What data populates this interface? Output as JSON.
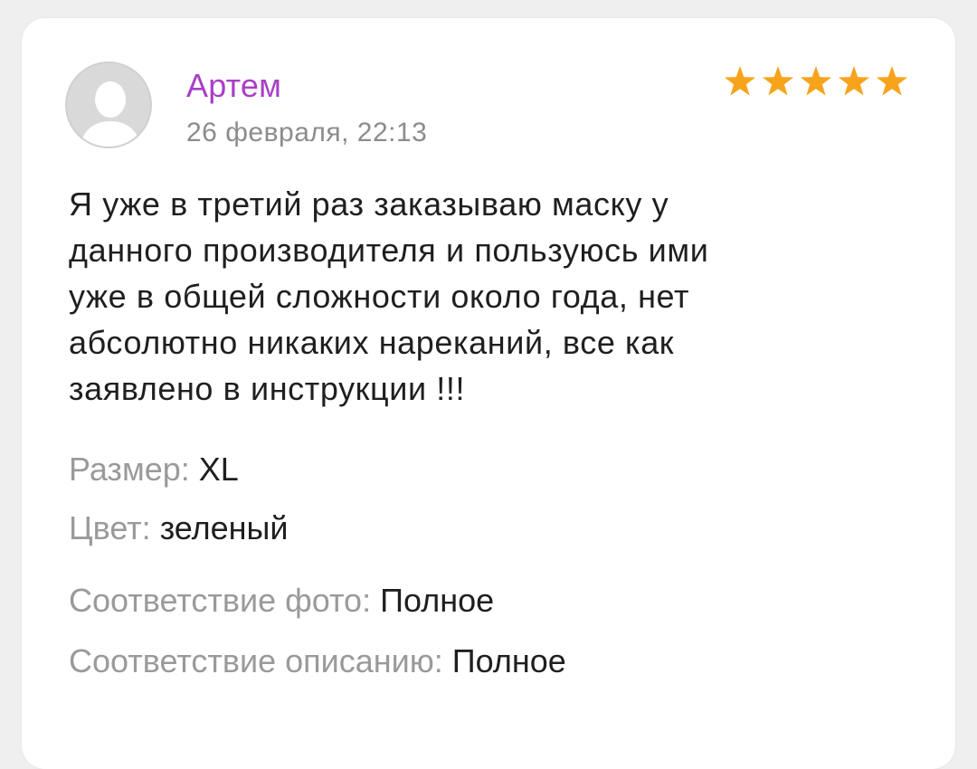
{
  "review": {
    "author": "Артем",
    "date": "26 февраля, 22:13",
    "rating": 5,
    "rating_max": 5,
    "text": "Я уже в третий  раз заказываю маску у\nданного производителя и пользуюсь ими\nуже  в общей сложности  около года, нет\nабсолютно никаких нареканий, все как\nзаявлено в инструкции !!!",
    "attributes": {
      "size_label": "Размер:",
      "size_value": "XL",
      "color_label": "Цвет:",
      "color_value": "зеленый",
      "photo_match_label": "Соответствие фото:",
      "photo_match_value": "Полное",
      "description_match_label": "Соответствие описанию:",
      "description_match_value": "Полное"
    }
  },
  "colors": {
    "author": "#a93fc6",
    "star": "#f7a41c",
    "muted": "#9a9a9a",
    "text": "#1f1f1f"
  },
  "icons": {
    "avatar": "user-placeholder-icon",
    "star": "star-icon"
  }
}
